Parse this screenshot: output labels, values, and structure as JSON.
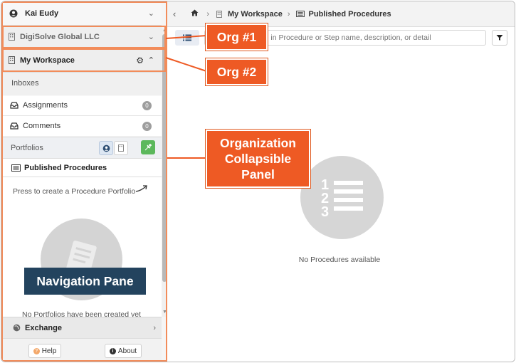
{
  "user": {
    "name": "Kai Eudy"
  },
  "orgs": [
    {
      "name": "DigiSolve Global LLC",
      "expanded": false
    },
    {
      "name": "My Workspace",
      "expanded": true
    }
  ],
  "inboxes": {
    "title": "Inboxes",
    "items": [
      {
        "label": "Assignments",
        "count": "0"
      },
      {
        "label": "Comments",
        "count": "0"
      }
    ]
  },
  "portfolios": {
    "title": "Portfolios",
    "published": "Published Procedures",
    "create_hint": "Press to create a Procedure Portfolio",
    "empty_text": "No Portfolios have been created yet"
  },
  "exchange": {
    "label": "Exchange"
  },
  "footer": {
    "help": "Help",
    "about": "About"
  },
  "breadcrumb": [
    "My Workspace",
    "Published Procedures"
  ],
  "search": {
    "placeholder": "Enter search term in Procedure or Step name, description, or detail"
  },
  "main": {
    "empty_text": "No Procedures available"
  },
  "callouts": {
    "org1": "Org #1",
    "org2": "Org #2",
    "panel": [
      "Organization",
      "Collapsible",
      "Panel"
    ],
    "nav": "Navigation Pane"
  },
  "colors": {
    "callout": "#ee5a24",
    "nav_label": "#23435e",
    "add_button": "#5cb85c"
  }
}
